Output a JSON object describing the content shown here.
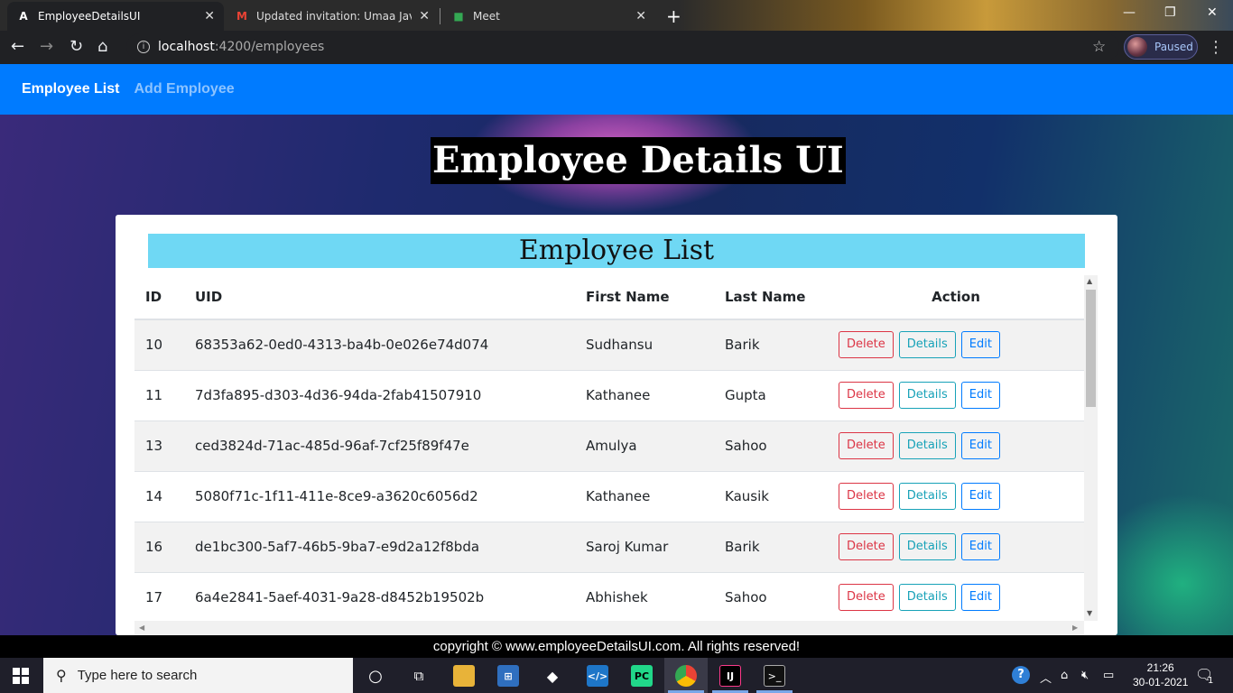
{
  "browser": {
    "tabs": [
      {
        "title": "EmployeeDetailsUI",
        "icon": "angular-icon"
      },
      {
        "title": "Updated invitation: Umaa Java S",
        "icon": "gmail-icon"
      },
      {
        "title": "Meet",
        "icon": "meet-icon"
      }
    ],
    "url_host": "localhost",
    "url_path": ":4200/employees",
    "profile_status": "Paused"
  },
  "navbar": {
    "items": [
      "Employee List",
      "Add Employee"
    ]
  },
  "page": {
    "heading": "Employee Details UI",
    "list_title": "Employee List"
  },
  "table": {
    "headers": [
      "ID",
      "UID",
      "First Name",
      "Last Name",
      "Action"
    ],
    "rows": [
      {
        "id": "10",
        "uid": "68353a62-0ed0-4313-ba4b-0e026e74d074",
        "first": "Sudhansu",
        "last": "Barik"
      },
      {
        "id": "11",
        "uid": "7d3fa895-d303-4d36-94da-2fab41507910",
        "first": "Kathanee",
        "last": "Gupta"
      },
      {
        "id": "13",
        "uid": "ced3824d-71ac-485d-96af-7cf25f89f47e",
        "first": "Amulya",
        "last": "Sahoo"
      },
      {
        "id": "14",
        "uid": "5080f71c-1f11-411e-8ce9-a3620c6056d2",
        "first": "Kathanee",
        "last": "Kausik"
      },
      {
        "id": "16",
        "uid": "de1bc300-5af7-46b5-9ba7-e9d2a12f8bda",
        "first": "Saroj Kumar",
        "last": "Barik"
      },
      {
        "id": "17",
        "uid": "6a4e2841-5aef-4031-9a28-d8452b19502b",
        "first": "Abhishek",
        "last": "Sahoo"
      }
    ],
    "action_labels": {
      "delete": "Delete",
      "details": "Details",
      "edit": "Edit"
    }
  },
  "footer": {
    "text": "copyright © www.employeeDetailsUI.com. All rights reserved!"
  },
  "taskbar": {
    "search_placeholder": "Type here to search",
    "time": "21:26",
    "date": "30-01-2021",
    "notification_count": "1"
  },
  "colors": {
    "navbar": "#007bff",
    "list_header": "#6fd8f4",
    "delete": "#dc3545",
    "details": "#17a2b8",
    "edit": "#007bff"
  }
}
